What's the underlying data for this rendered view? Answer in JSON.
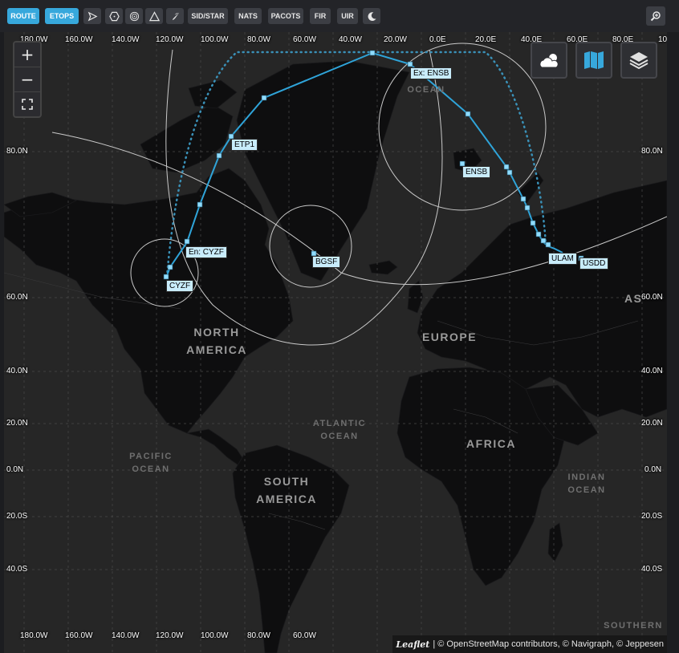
{
  "toolbar": {
    "route": "ROUTE",
    "etops": "ETOPS",
    "sidstar": "SID/STAR",
    "nats": "NATS",
    "pacots": "PACOTS",
    "fir": "FIR",
    "uir": "UIR",
    "icons": [
      "plane-icon",
      "hexagon-icon",
      "radar-icon",
      "triangle-icon",
      "rocket-icon",
      "moon-icon",
      "zoom-search-icon"
    ],
    "active_color": "#37a8dc"
  },
  "map": {
    "zoom_in": "+",
    "zoom_out": "−",
    "fullscreen_icon": "fullscreen-icon",
    "controls": [
      "weather-icon",
      "map-icon",
      "layers-icon"
    ],
    "longitudes_top": [
      "180.0W",
      "160.0W",
      "140.0W",
      "120.0W",
      "100.0W",
      "80.0W",
      "60.0W",
      "40.0W",
      "20.0W",
      "0.0E",
      "20.0E",
      "40.0E",
      "60.0E",
      "80.0E",
      "10"
    ],
    "longitudes_bottom": [
      "180.0W",
      "160.0W",
      "140.0W",
      "120.0W",
      "100.0W",
      "80.0W",
      "60.0W"
    ],
    "latitudes": [
      "80.0N",
      "60.0N",
      "40.0N",
      "20.0N",
      "0.0N",
      "20.0S",
      "40.0S"
    ],
    "regions": {
      "north_america": [
        "NORTH",
        "AMERICA"
      ],
      "europe": "EUROPE",
      "africa": "AFRICA",
      "south_america": [
        "SOUTH",
        "AMERICA"
      ],
      "atlantic": [
        "ATLANTIC",
        "OCEAN"
      ],
      "pacific": [
        "PACIFIC",
        "OCEAN"
      ],
      "indian": [
        "INDIAN",
        "OCEAN"
      ],
      "arctic": "OCEAN",
      "asia": "AS",
      "southern": "SOUTHERN"
    },
    "waypoints": {
      "cyzf": "CYZF",
      "en_cyzf": "En: CYZF",
      "etp1": "ETP1",
      "bgsf": "BGSF",
      "ex_ensb": "Ex: ENSB",
      "ensb": "ENSB",
      "ulam": "ULAM",
      "usdd": "USDD"
    },
    "route_color": "#2fa4d9",
    "etops_circle_color": "#c9c9c9"
  },
  "attribution": {
    "leaflet": "Leaflet",
    "text": "| © OpenStreetMap contributors, © Navigraph, © Jeppesen"
  }
}
